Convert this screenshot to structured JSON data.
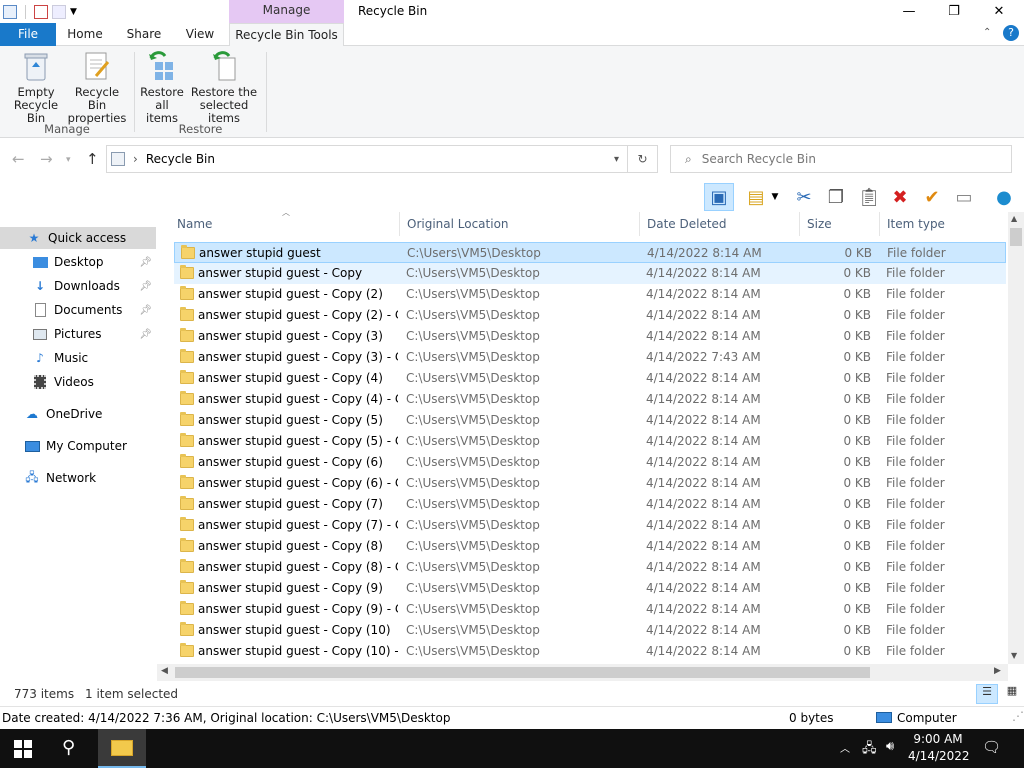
{
  "window": {
    "title": "Recycle Bin",
    "context_tab": "Manage",
    "minimize": "—",
    "maximize": "❐",
    "close": "✕"
  },
  "ribbon_tabs": {
    "file": "File",
    "home": "Home",
    "share": "Share",
    "view": "View",
    "tools": "Recycle Bin Tools"
  },
  "ribbon": {
    "empty_l1": "Empty",
    "empty_l2": "Recycle Bin",
    "props_l1": "Recycle Bin",
    "props_l2": "properties",
    "restore_all_l1": "Restore",
    "restore_all_l2": "all items",
    "restore_sel_l1": "Restore the",
    "restore_sel_l2": "selected items",
    "group_manage": "Manage",
    "group_restore": "Restore"
  },
  "address": {
    "crumb_sep": "›",
    "location": "Recycle Bin",
    "search_placeholder": "Search Recycle Bin"
  },
  "nav": {
    "quick_access": "Quick access",
    "desktop": "Desktop",
    "downloads": "Downloads",
    "documents": "Documents",
    "pictures": "Pictures",
    "music": "Music",
    "videos": "Videos",
    "onedrive": "OneDrive",
    "my_computer": "My Computer",
    "network": "Network"
  },
  "columns": {
    "name": "Name",
    "location": "Original Location",
    "date": "Date Deleted",
    "size": "Size",
    "type": "Item type"
  },
  "files": [
    {
      "name": "answer stupid guest",
      "loc": "C:\\Users\\VM5\\Desktop",
      "date": "4/14/2022 8:14 AM",
      "size": "0 KB",
      "type": "File folder"
    },
    {
      "name": "answer stupid guest - Copy",
      "loc": "C:\\Users\\VM5\\Desktop",
      "date": "4/14/2022 8:14 AM",
      "size": "0 KB",
      "type": "File folder"
    },
    {
      "name": "answer stupid guest - Copy (2)",
      "loc": "C:\\Users\\VM5\\Desktop",
      "date": "4/14/2022 8:14 AM",
      "size": "0 KB",
      "type": "File folder"
    },
    {
      "name": "answer stupid guest - Copy (2) - C...",
      "loc": "C:\\Users\\VM5\\Desktop",
      "date": "4/14/2022 8:14 AM",
      "size": "0 KB",
      "type": "File folder"
    },
    {
      "name": "answer stupid guest - Copy (3)",
      "loc": "C:\\Users\\VM5\\Desktop",
      "date": "4/14/2022 8:14 AM",
      "size": "0 KB",
      "type": "File folder"
    },
    {
      "name": "answer stupid guest - Copy (3) - C...",
      "loc": "C:\\Users\\VM5\\Desktop",
      "date": "4/14/2022 7:43 AM",
      "size": "0 KB",
      "type": "File folder"
    },
    {
      "name": "answer stupid guest - Copy (4)",
      "loc": "C:\\Users\\VM5\\Desktop",
      "date": "4/14/2022 8:14 AM",
      "size": "0 KB",
      "type": "File folder"
    },
    {
      "name": "answer stupid guest - Copy (4) - C...",
      "loc": "C:\\Users\\VM5\\Desktop",
      "date": "4/14/2022 8:14 AM",
      "size": "0 KB",
      "type": "File folder"
    },
    {
      "name": "answer stupid guest - Copy (5)",
      "loc": "C:\\Users\\VM5\\Desktop",
      "date": "4/14/2022 8:14 AM",
      "size": "0 KB",
      "type": "File folder"
    },
    {
      "name": "answer stupid guest - Copy (5) - C...",
      "loc": "C:\\Users\\VM5\\Desktop",
      "date": "4/14/2022 8:14 AM",
      "size": "0 KB",
      "type": "File folder"
    },
    {
      "name": "answer stupid guest - Copy (6)",
      "loc": "C:\\Users\\VM5\\Desktop",
      "date": "4/14/2022 8:14 AM",
      "size": "0 KB",
      "type": "File folder"
    },
    {
      "name": "answer stupid guest - Copy (6) - C...",
      "loc": "C:\\Users\\VM5\\Desktop",
      "date": "4/14/2022 8:14 AM",
      "size": "0 KB",
      "type": "File folder"
    },
    {
      "name": "answer stupid guest - Copy (7)",
      "loc": "C:\\Users\\VM5\\Desktop",
      "date": "4/14/2022 8:14 AM",
      "size": "0 KB",
      "type": "File folder"
    },
    {
      "name": "answer stupid guest - Copy (7) - C...",
      "loc": "C:\\Users\\VM5\\Desktop",
      "date": "4/14/2022 8:14 AM",
      "size": "0 KB",
      "type": "File folder"
    },
    {
      "name": "answer stupid guest - Copy (8)",
      "loc": "C:\\Users\\VM5\\Desktop",
      "date": "4/14/2022 8:14 AM",
      "size": "0 KB",
      "type": "File folder"
    },
    {
      "name": "answer stupid guest - Copy (8) - C...",
      "loc": "C:\\Users\\VM5\\Desktop",
      "date": "4/14/2022 8:14 AM",
      "size": "0 KB",
      "type": "File folder"
    },
    {
      "name": "answer stupid guest - Copy (9)",
      "loc": "C:\\Users\\VM5\\Desktop",
      "date": "4/14/2022 8:14 AM",
      "size": "0 KB",
      "type": "File folder"
    },
    {
      "name": "answer stupid guest - Copy (9) - C...",
      "loc": "C:\\Users\\VM5\\Desktop",
      "date": "4/14/2022 8:14 AM",
      "size": "0 KB",
      "type": "File folder"
    },
    {
      "name": "answer stupid guest - Copy (10)",
      "loc": "C:\\Users\\VM5\\Desktop",
      "date": "4/14/2022 8:14 AM",
      "size": "0 KB",
      "type": "File folder"
    },
    {
      "name": "answer stupid guest - Copy (10) - ...",
      "loc": "C:\\Users\\VM5\\Desktop",
      "date": "4/14/2022 8:14 AM",
      "size": "0 KB",
      "type": "File folder"
    }
  ],
  "status": {
    "count": "773 items",
    "selected": "1 item selected"
  },
  "details": {
    "info": "Date created: 4/14/2022 7:36 AM, Original location: C:\\Users\\VM5\\Desktop",
    "size": "0 bytes",
    "computer": "Computer"
  },
  "taskbar": {
    "time": "9:00 AM",
    "date": "4/14/2022"
  },
  "colors": {
    "accent": "#1979ca",
    "selection": "#cce8ff",
    "context_tab": "#e5c8f3"
  }
}
